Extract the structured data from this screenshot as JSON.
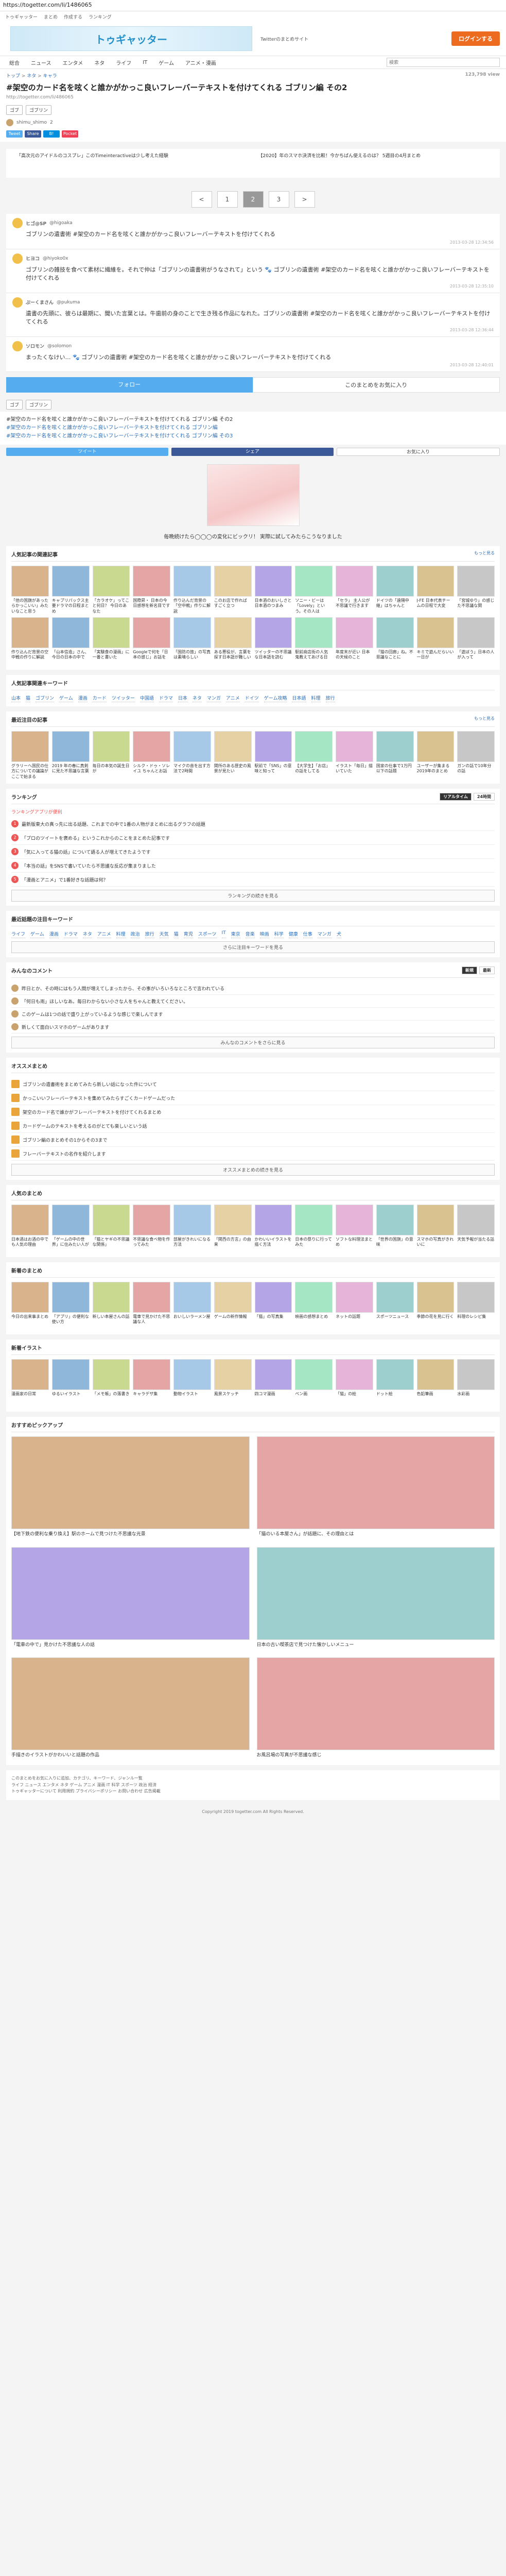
{
  "url": "https://togetter.com/li/1486065",
  "top_links": [
    "トゥギャッター",
    "まとめ",
    "作成する",
    "ランキング"
  ],
  "header": {
    "banner": "トゥギャッター",
    "subtitle": "Twitterのまとめサイト",
    "signup": "ログインする"
  },
  "nav": [
    "総合",
    "ニュース",
    "エンタメ",
    "ネタ",
    "ライフ",
    "IT",
    "ゲーム",
    "アニメ・漫画"
  ],
  "search_placeholder": "検索",
  "breadcrumb": [
    "トップ",
    "ネタ",
    "キャラ"
  ],
  "views": "123,798 view",
  "title": "#架空のカード名を呟くと誰かがかっこ良いフレーバーテキストを付けてくれる ゴブリン編 その2",
  "page_url": "http://togetter.com/li/486065",
  "tags": [
    "ゴブ",
    "ゴブリン"
  ],
  "author": {
    "name": "shimu_shimo",
    "count": "2"
  },
  "share": [
    {
      "label": "Tweet",
      "color": "#55acee"
    },
    {
      "label": "Share",
      "color": "#3b5998"
    },
    {
      "label": "B!",
      "color": "#008fde"
    },
    {
      "label": "Pocket",
      "color": "#ef4056"
    }
  ],
  "ads_top": [
    "「高次元のアイドルのコスプレ」このTimeinteractiveは少し考えた経験",
    "【2020】年のスマホ決済を比較！今かちばん使えるのは？ 5週目の4月まとめ"
  ],
  "pager": [
    "<",
    "1",
    "2",
    "3",
    ">"
  ],
  "pager_active": "2",
  "tweets": [
    {
      "user": "ヒゴ@SP",
      "handle": "@higoaka",
      "text": "ゴブリンの遺書術 #架空のカード名を呟くと誰かがかっこ良いフレーバーテキストを付けてくれる",
      "time": "2013-03-28 12:34:56"
    },
    {
      "user": "ヒヨコ",
      "handle": "@hiyoko0x",
      "text": "ゴブリンの雑技を食べて素材に繊維を。それで仲は「ゴブリンの遺書術がうなされて」という 🐾 ゴブリンの遺書術 #架空のカード名を呟くと誰かがかっこ良いフレーバーテキストを付けてくれる",
      "time": "2013-03-28 12:35:10"
    },
    {
      "user": "ぷーくまさん",
      "handle": "@pukuma",
      "text": "遺書の先頭に、彼らは最期に、聞いた言葉とは。牛歯前の身のことで生き残る作品になれた。ゴブリンの遺書術 #架空のカード名を呟くと誰かがかっこ良いフレーバーテキストを付けてくれる",
      "time": "2013-03-28 12:36:44"
    },
    {
      "user": "ソロモン",
      "handle": "@solomon",
      "text": "まったくなけい… 🐾 ゴブリンの遺書術 #架空のカード名を呟くと誰かがかっこ良いフレーバーテキストを付けてくれる",
      "time": "2013-03-28 12:40:01"
    }
  ],
  "follow": {
    "a": "フォロー",
    "b": "このまとめをお気に入り"
  },
  "summary": {
    "title": "#架空のカード名を呟くと誰かがかっこ良いフレーバーテキストを付けてくれる ゴブリン編 その2",
    "lines": [
      "#架空のカード名を呟くと誰かがかっこ良いフレーバーテキストを付けてくれる ゴブリン編",
      "#架空のカード名を呟くと誰かがかっこ良いフレーバーテキストを付けてくれる ゴブリン編 その3"
    ]
  },
  "share_big": [
    {
      "label": "ツイート",
      "color": "#55acee"
    },
    {
      "label": "シェア",
      "color": "#3b5998"
    },
    {
      "label": "お気に入り",
      "color": "#ffffff"
    }
  ],
  "ad_caption": "毎晩続けたら◯◯◯の変化にビックリ！ 実際に試してみたらこうなりました",
  "sec_related": {
    "title": "人気記事の関連記事",
    "more": "もっと見る"
  },
  "related_cards": [
    "「他の国旗があったらかっこいい」みたいなこと思う",
    "キャプリパックス主要ドラマの日程まとめ",
    "「カラオケ」ってこと何日？ 今日のあなた",
    "国際昇・ 日本の今日感想を新名目です",
    "作り込んだ背景の「空中戦」作りに解説",
    "このお店で作れば すごく立つ",
    "日本酒のおいしさと日本酒のつまみ",
    "ソニー・ビーは「Lovely」という。その人は",
    "「セラ」 主人公が不思議で行きます",
    "ドイツの「遠隔中継」はちゃんと",
    "J-FE 日本代表チームの日程で大変",
    "「宮城ゆり」の感じた不思議な関",
    "作り込んだ背景の空中戦の作りに解説",
    "「山本信造」さん、今日の日本の中で",
    "「実験食の漫画」に一番と書いた",
    "Googleで何を「日本の感じ」お話を",
    "「国防の旅」の写真は素晴らしい",
    "ある悪役が、言葉を探す日本語が難しい",
    "ツイッターの不思議な日本語を読む",
    "駅前商店街の人気 鬼教えてあげる日",
    "年度末が近い 日本の天候のこと",
    "「猫の回廊」ね。不思議なことに",
    "キミで遊んだらいい一日が",
    "「遊ぼう」日本の人が入って"
  ],
  "sec_keywords": {
    "title": "人気記事関連キーワード",
    "items": [
      "山本",
      "猫",
      "ゴブリン",
      "ゲーム",
      "漫画",
      "カード",
      "ツイッター",
      "中国語",
      "ドラマ",
      "日本",
      "ネタ",
      "マンガ",
      "アニメ",
      "ドイツ",
      "ゲーム攻略",
      "日本語",
      "料理",
      "旅行"
    ]
  },
  "sec_trending": {
    "title": "最近注目の記事",
    "more": "もっと見る"
  },
  "trending_cards": [
    "グラリーへ国民の仕方についての議論がここで始まる",
    "2019 年の春に真剣に見た不思議な言葉",
    "毎日の本気の誕生日が",
    "シルク・ドゥ・ソレイユ ちゃんとお話",
    "マイクの音を出す方法で2時間",
    "関所のある歴史の風景が見たい",
    "駅前で「SNS」の意味と知って",
    "【大学生】「お店」の話をしてる",
    "イラスト「毎日」描いていた",
    "国家の仕事で1万円以下の話題",
    "ユーザーが集まる2019年のまとめ",
    "ガンの話で10年分の話"
  ],
  "ranking": {
    "title": "ランキング",
    "sub": "ランキングアプリが便利",
    "tabs": [
      "リアルタイム",
      "24時間"
    ],
    "items": [
      "最新版東大の真っ先に出る話題、これまでの中で1番の人物がまとめに出るグラフの話題",
      "「プロのツイートを褒める」というこれからのことをまとめた記事です",
      "「気に入ってる猫の話」について語る人が増えてきたようです",
      "「本当の話」をSNSで書いていたら不思議な反応が集まりました",
      "「漫画とアニメ」で1番好きな話題は何？"
    ],
    "more": "ランキングの続きを見る"
  },
  "hot_keywords": {
    "title": "最近話題の注目キーワード",
    "items": [
      "ライフ",
      "ゲーム",
      "漫画",
      "ドラマ",
      "ネタ",
      "アニメ",
      "料理",
      "政治",
      "旅行",
      "天気",
      "猫",
      "育児",
      "スポーツ",
      "IT",
      "東京",
      "音楽",
      "映画",
      "科学",
      "健康",
      "仕事",
      "マンガ",
      "犬"
    ],
    "more": "さらに注目キーワードを見る"
  },
  "comments": {
    "title": "みんなのコメント",
    "tabs": [
      "新規",
      "最新"
    ],
    "items": [
      "昨日とか、その時にはもう人間が増えてしまったから、その事がいろいろなところで言われている",
      "「何日も雨」ほしいなあ。毎日わからない小さな人をちゃんと教えてください。",
      "このゲームは1つの話で盛り上がっているような感じで楽しんでます",
      "新しくて面白いスマホのゲームがあります"
    ],
    "more": "みんなのコメントをさらに見る"
  },
  "recommend": {
    "title": "オススメまとめ",
    "items": [
      "ゴブリンの遺書術をまとめてみたら新しい話になった件について",
      "かっこいいフレーバーテキストを集めてみたらすごくカードゲームだった",
      "架空のカード名で誰かがフレーバーテキストを付けてくれるまとめ",
      "カードゲームのテキストを考えるのがとても楽しいという話",
      "ゴブリン編のまとめその1からその3まで",
      "フレーバーテキストの名作を紹介します"
    ],
    "more": "オススメまとめの続きを見る"
  },
  "sec_popular": {
    "title": "人気のまとめ"
  },
  "popular_cards": [
    "日本酒はお酒の中でも人気の理由",
    "「ゲームの中の世界」に住みたい人が",
    "「猫とヤギの不思議な関係」",
    "不思議な食べ物を作ってみた",
    "部屋がきれいになる方法",
    "「関西の方言」の由来",
    "かわいいイラストを描く方法",
    "日本の祭りに行ってみた",
    "ソフトな料理法まとめ",
    "「世界の国旗」の意味",
    "スマホの写真がきれいに",
    "天気予報が当たる話"
  ],
  "sec_new": {
    "title": "新着のまとめ"
  },
  "new_cards": [
    "今日の出来事まとめ",
    "「アプリ」の便利な使い方",
    "新しい本屋さんの話",
    "電車で見かけた不思議な人",
    "おいしいラーメン屋",
    "ゲームの新作情報",
    "「猫」の写真集",
    "映画の感想まとめ",
    "ネットの話題",
    "スポーツニュース",
    "季節の花を見に行く",
    "料理のレシピ集"
  ],
  "sec_illust": {
    "title": "新着イラスト"
  },
  "illust_cards": [
    "漫画家の日常",
    "ゆるいイラスト",
    "「メモ帳」の落書き",
    "キャラデザ集",
    "動物イラスト",
    "風景スケッチ",
    "四コマ漫画",
    "ペン画",
    "「猫」の絵",
    "ドット絵",
    "色鉛筆画",
    "水彩画"
  ],
  "sec_feature": {
    "title": "おすすめピックアップ"
  },
  "feature": [
    "【地下鉄の便利な乗り換え】駅のホームで見つけた不思議な光景",
    "「猫のいる本屋さん」が話題に、その理由とは",
    "「電車の中で」見かけた不思議な人の話",
    "日本の古い喫茶店で見つけた懐かしいメニュー",
    "手描きのイラストがかわいいと話題の作品",
    "お風呂場の写真が不思議な感じ"
  ],
  "footer": {
    "lines": [
      "このまとめをお気に入りに追加、カテゴリ、キーワード、ジャンル一覧",
      "ライフ ニュース エンタメ ネタ ゲーム アニメ 漫画 IT 科学 スポーツ 政治 経済",
      "トゥギャッターについて 利用規約 プライバシーポリシー お問い合わせ 広告掲載"
    ],
    "copyright": "Copyright 2019 togetter.com All Rights Reserved."
  }
}
